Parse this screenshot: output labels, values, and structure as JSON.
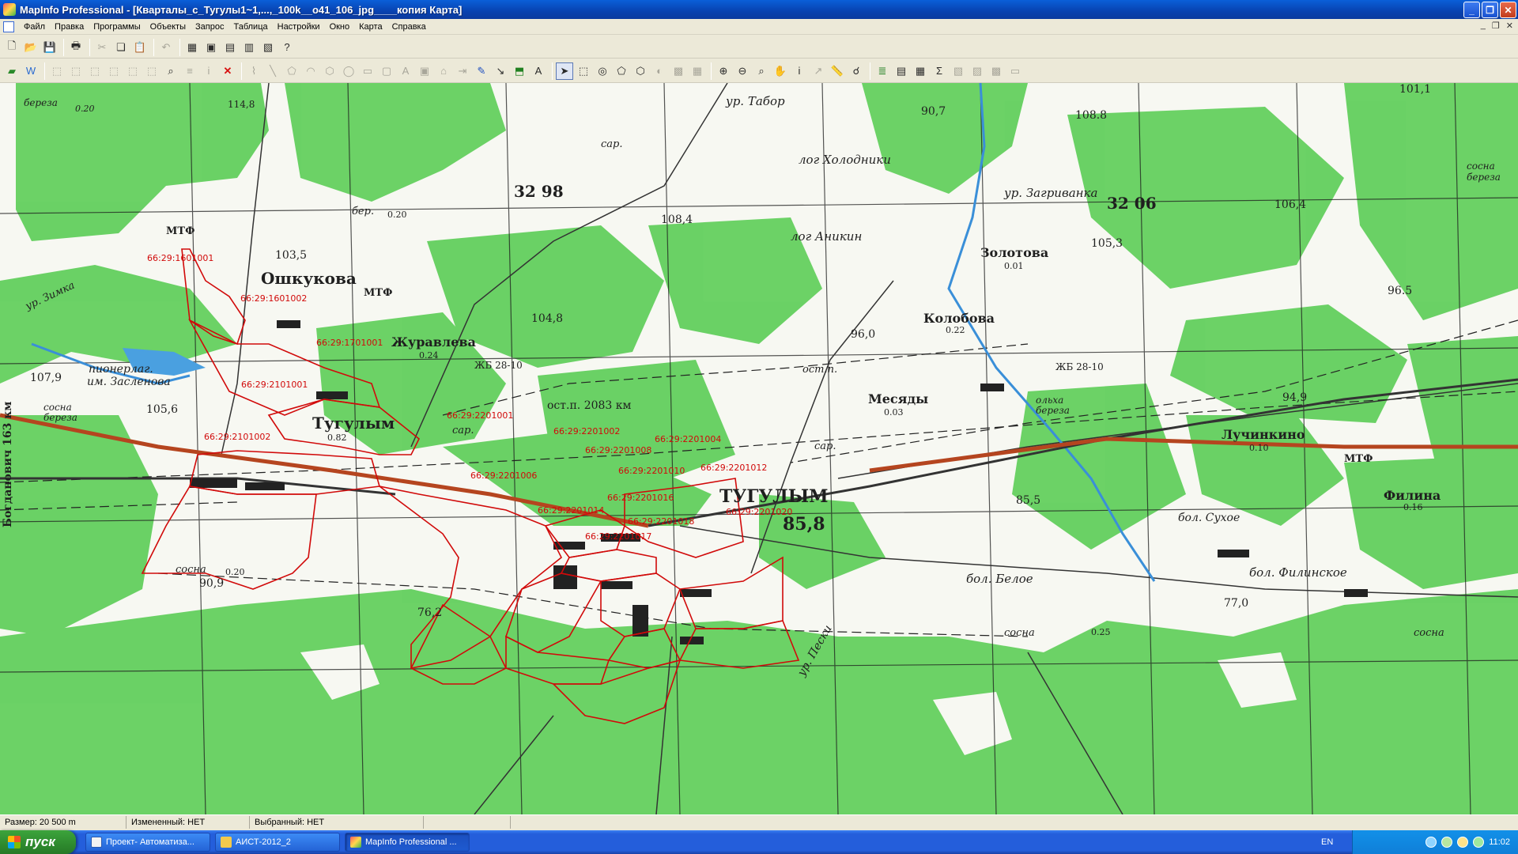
{
  "window": {
    "title": "MapInfo Professional - [Кварталы_с_Тугулы1~1,...,_100k__o41_106_jpg____копия Карта]",
    "buttons": [
      "_",
      "❐",
      "✕"
    ]
  },
  "menu": {
    "items": [
      "Файл",
      "Правка",
      "Программы",
      "Объекты",
      "Запрос",
      "Таблица",
      "Настройки",
      "Окно",
      "Карта",
      "Справка"
    ],
    "mdi_buttons": [
      "_",
      "❐",
      "✕"
    ]
  },
  "map": {
    "labels": {
      "bereza_nw": "береза",
      "bereza_nw_num": "0.20",
      "ur_tabor": "ур. Табор",
      "log_holodniki": "лог Холодники",
      "ur_zagrivanka": "ур. Загриванка",
      "log_anikin": "лог Аникин",
      "zolotova": "Золотова",
      "zolotova_num": "0.01",
      "bereza_ne": "сосна береза",
      "mtf_1": "МТФ",
      "oshkukova": "Ошкукова",
      "mtf_2": "МТФ",
      "bereza_mid": "бер.",
      "bereza_mid_num": "0.20",
      "zhuravleva": "Журавлева",
      "zhuravleva_num": "0.24",
      "kolobova": "Колобова",
      "kolobova_num": "0.22",
      "pionerlag": "пионерлаг.",
      "zaslonova": "им. Засленова",
      "ostp_2083": "ост.п. 2083 км",
      "ostp": "ост.п.",
      "mesyady": "Месяды",
      "mesyady_num": "0.03",
      "tugulym_w": "Тугулым",
      "tugulym_w_num": "0.82",
      "tugulym": "ТУГУЛЫМ",
      "luchinkino": "Лучинкино",
      "luchinkino_num": "0.10",
      "filina": "Филина",
      "filina_num": "0.16",
      "mtf_3": "МТФ",
      "bol_suhoe": "бол. Сухое",
      "bol_beloe": "бол. Белое",
      "bol_filinskoe": "бол. Филинское",
      "ur_peski": "ур. Пески",
      "sosna_sw": "сосна",
      "sosna_sw_num": "0.20",
      "sosna_s": "сосна",
      "sosna_s_num": "0.25",
      "sosna_se": "сосна",
      "bogdanovich": "Богданович 163 км",
      "sar_1": "сар.",
      "sar_2": "сар.",
      "sar_3": "сар.",
      "sosna_bereza_w": "сосна береза",
      "olha_bereza": "ольха береза",
      "zhb_1": "ЖБ 28-10",
      "zhb_2": "ЖБ 28-10",
      "ur_zimka": "ур. Зимка",
      "grid_32_98": "32 98",
      "grid_32_06": "32 06",
      "elev_108_4": "108,4",
      "elev_108_8": "108.8",
      "elev_106_4": "106,4",
      "elev_105_3": "105,3",
      "elev_103_5": "103,5",
      "elev_104_8": "104,8",
      "elev_96_0": "96,0",
      "elev_96_5": "96.5",
      "elev_94_9": "94,9",
      "elev_85_8": "85,8",
      "elev_85_5": "85,5",
      "elev_107_9": "107,9",
      "elev_105_6": "105,6",
      "elev_90_9": "90,9",
      "elev_76_2": "76,2",
      "elev_77_0": "77,0",
      "elev_114_8": "114,8",
      "elev_90_7": "90,7",
      "elev_101": "101,1"
    },
    "parcels": [
      {
        "id": "66:29:1601001"
      },
      {
        "id": "66:29:1601002"
      },
      {
        "id": "66:29:1701001"
      },
      {
        "id": "66:29:2101001"
      },
      {
        "id": "66:29:2101002"
      },
      {
        "id": "66:29:2201001"
      },
      {
        "id": "66:29:2201002"
      },
      {
        "id": "66:29:2201004"
      },
      {
        "id": "66:29:2201008"
      },
      {
        "id": "66:29:2201006"
      },
      {
        "id": "66:29:2201010"
      },
      {
        "id": "66:29:2201012"
      },
      {
        "id": "66:29:2201016"
      },
      {
        "id": "66:29:2201014"
      },
      {
        "id": "66:29:2201018"
      },
      {
        "id": "66:29:2201020"
      },
      {
        "id": "66:29:2201017"
      }
    ],
    "colors": {
      "forest": "#5fce5a",
      "field": "#f7f8f2",
      "parcel_border": "#d10a0a",
      "railway": "#b5451f",
      "water": "#3a8fd8"
    }
  },
  "status": {
    "size": "Размер: 20 500 m",
    "changed": "Измененный: НЕТ",
    "selected": "Выбранный: НЕТ"
  },
  "taskbar": {
    "start": "пуск",
    "tasks": [
      "Проект- Автоматиза...",
      "АИСТ-2012_2",
      "MapInfo Professional ..."
    ],
    "lang": "EN",
    "clock": "11:02"
  }
}
